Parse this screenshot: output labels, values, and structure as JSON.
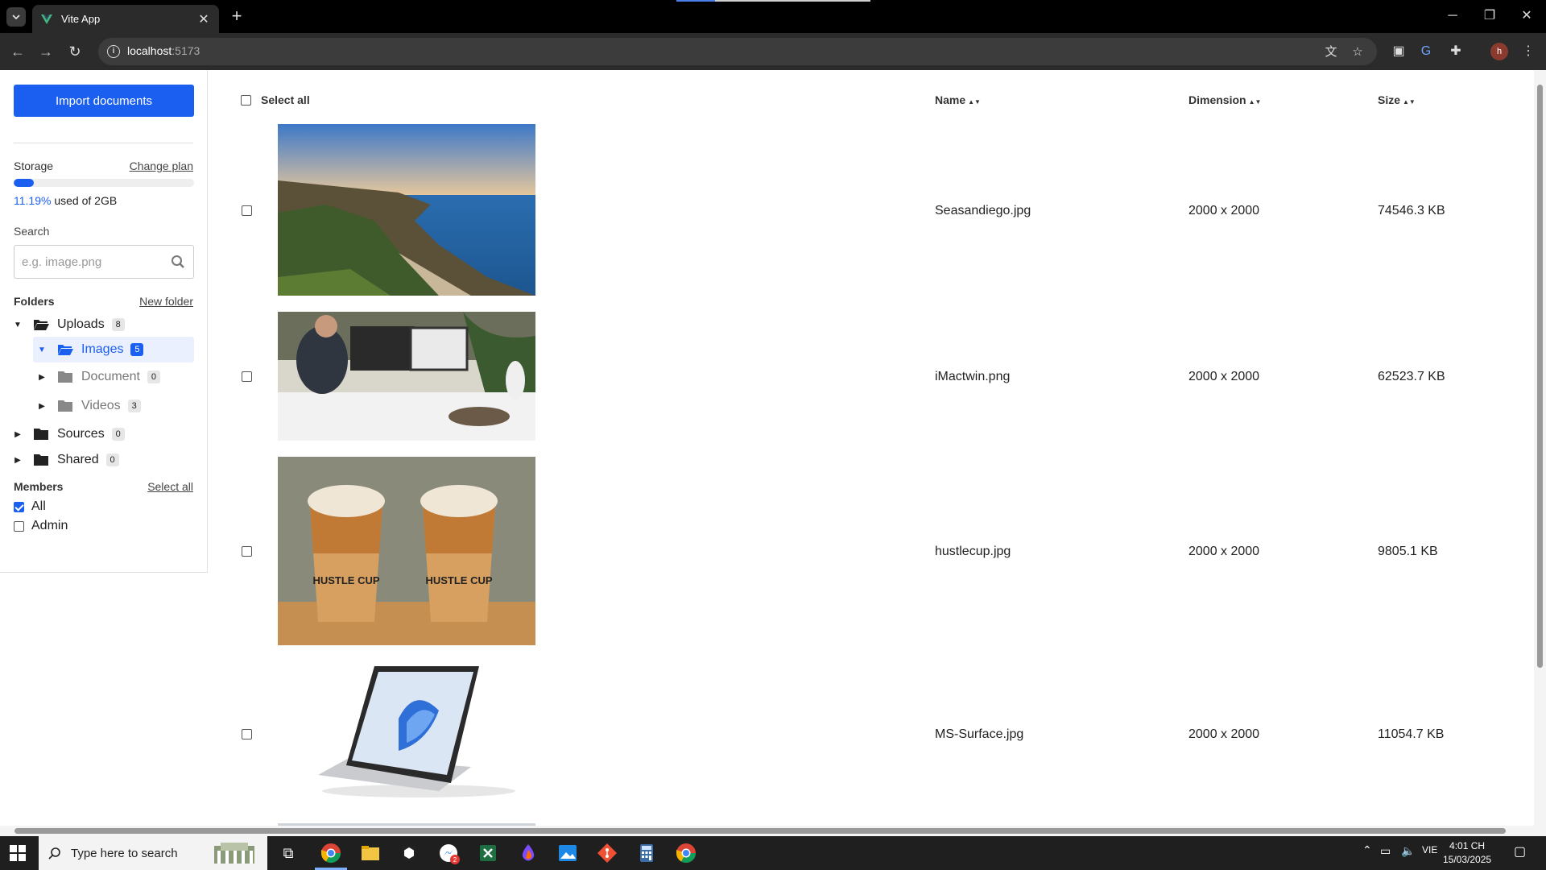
{
  "browser": {
    "tab_title": "Vite App",
    "url_host": "localhost",
    "url_port": ":5173",
    "profile_initial": "h"
  },
  "sidebar": {
    "import_label": "Import documents",
    "storage_label": "Storage",
    "change_plan": "Change plan",
    "storage_used_fraction": 0.1119,
    "storage_pct": "11.19%",
    "storage_rest": " used of 2GB",
    "search_label": "Search",
    "search_placeholder": "e.g. image.png",
    "folders_label": "Folders",
    "new_folder": "New folder",
    "folders": [
      {
        "label": "Uploads",
        "count": "8"
      },
      {
        "label": "Images",
        "count": "5"
      },
      {
        "label": "Document",
        "count": "0"
      },
      {
        "label": "Videos",
        "count": "3"
      },
      {
        "label": "Sources",
        "count": "0"
      },
      {
        "label": "Shared",
        "count": "0"
      }
    ],
    "members_label": "Members",
    "members_select_all": "Select all",
    "members": [
      {
        "label": "All",
        "checked": true
      },
      {
        "label": "Admin",
        "checked": false
      }
    ]
  },
  "table": {
    "select_all": "Select all",
    "col_name": "Name",
    "col_dimension": "Dimension",
    "col_size": "Size",
    "rows": [
      {
        "name": "Seasandiego.jpg",
        "dimension": "2000 x 2000",
        "size": "74546.3 KB"
      },
      {
        "name": "iMactwin.png",
        "dimension": "2000 x 2000",
        "size": "62523.7 KB"
      },
      {
        "name": "hustlecup.jpg",
        "dimension": "2000 x 2000",
        "size": "9805.1 KB"
      },
      {
        "name": "MS-Surface.jpg",
        "dimension": "2000 x 2000",
        "size": "11054.7 KB"
      }
    ],
    "cup_text": "HUSTLE CUP"
  },
  "taskbar": {
    "search_text": "Type here to search",
    "language": "VIE",
    "time": "4:01 CH",
    "date": "15/03/2025",
    "notification_count": "2"
  },
  "colors": {
    "accent": "#1a5ff0"
  }
}
